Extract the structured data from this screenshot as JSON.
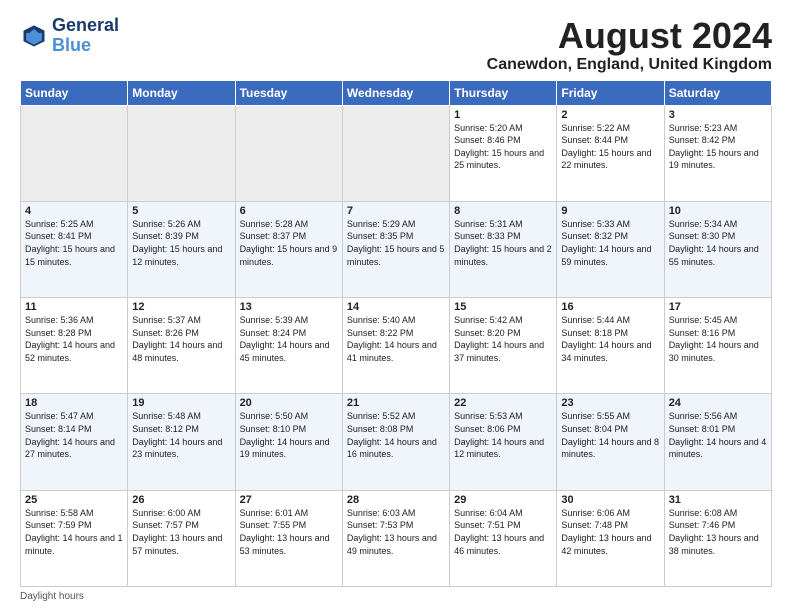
{
  "header": {
    "logo_line1": "General",
    "logo_line2": "Blue",
    "main_title": "August 2024",
    "subtitle": "Canewdon, England, United Kingdom"
  },
  "columns": [
    "Sunday",
    "Monday",
    "Tuesday",
    "Wednesday",
    "Thursday",
    "Friday",
    "Saturday"
  ],
  "weeks": [
    [
      {
        "day": "",
        "empty": true
      },
      {
        "day": "",
        "empty": true
      },
      {
        "day": "",
        "empty": true
      },
      {
        "day": "",
        "empty": true
      },
      {
        "day": "1",
        "sunrise": "Sunrise: 5:20 AM",
        "sunset": "Sunset: 8:46 PM",
        "daylight": "Daylight: 15 hours and 25 minutes."
      },
      {
        "day": "2",
        "sunrise": "Sunrise: 5:22 AM",
        "sunset": "Sunset: 8:44 PM",
        "daylight": "Daylight: 15 hours and 22 minutes."
      },
      {
        "day": "3",
        "sunrise": "Sunrise: 5:23 AM",
        "sunset": "Sunset: 8:42 PM",
        "daylight": "Daylight: 15 hours and 19 minutes."
      }
    ],
    [
      {
        "day": "4",
        "sunrise": "Sunrise: 5:25 AM",
        "sunset": "Sunset: 8:41 PM",
        "daylight": "Daylight: 15 hours and 15 minutes."
      },
      {
        "day": "5",
        "sunrise": "Sunrise: 5:26 AM",
        "sunset": "Sunset: 8:39 PM",
        "daylight": "Daylight: 15 hours and 12 minutes."
      },
      {
        "day": "6",
        "sunrise": "Sunrise: 5:28 AM",
        "sunset": "Sunset: 8:37 PM",
        "daylight": "Daylight: 15 hours and 9 minutes."
      },
      {
        "day": "7",
        "sunrise": "Sunrise: 5:29 AM",
        "sunset": "Sunset: 8:35 PM",
        "daylight": "Daylight: 15 hours and 5 minutes."
      },
      {
        "day": "8",
        "sunrise": "Sunrise: 5:31 AM",
        "sunset": "Sunset: 8:33 PM",
        "daylight": "Daylight: 15 hours and 2 minutes."
      },
      {
        "day": "9",
        "sunrise": "Sunrise: 5:33 AM",
        "sunset": "Sunset: 8:32 PM",
        "daylight": "Daylight: 14 hours and 59 minutes."
      },
      {
        "day": "10",
        "sunrise": "Sunrise: 5:34 AM",
        "sunset": "Sunset: 8:30 PM",
        "daylight": "Daylight: 14 hours and 55 minutes."
      }
    ],
    [
      {
        "day": "11",
        "sunrise": "Sunrise: 5:36 AM",
        "sunset": "Sunset: 8:28 PM",
        "daylight": "Daylight: 14 hours and 52 minutes."
      },
      {
        "day": "12",
        "sunrise": "Sunrise: 5:37 AM",
        "sunset": "Sunset: 8:26 PM",
        "daylight": "Daylight: 14 hours and 48 minutes."
      },
      {
        "day": "13",
        "sunrise": "Sunrise: 5:39 AM",
        "sunset": "Sunset: 8:24 PM",
        "daylight": "Daylight: 14 hours and 45 minutes."
      },
      {
        "day": "14",
        "sunrise": "Sunrise: 5:40 AM",
        "sunset": "Sunset: 8:22 PM",
        "daylight": "Daylight: 14 hours and 41 minutes."
      },
      {
        "day": "15",
        "sunrise": "Sunrise: 5:42 AM",
        "sunset": "Sunset: 8:20 PM",
        "daylight": "Daylight: 14 hours and 37 minutes."
      },
      {
        "day": "16",
        "sunrise": "Sunrise: 5:44 AM",
        "sunset": "Sunset: 8:18 PM",
        "daylight": "Daylight: 14 hours and 34 minutes."
      },
      {
        "day": "17",
        "sunrise": "Sunrise: 5:45 AM",
        "sunset": "Sunset: 8:16 PM",
        "daylight": "Daylight: 14 hours and 30 minutes."
      }
    ],
    [
      {
        "day": "18",
        "sunrise": "Sunrise: 5:47 AM",
        "sunset": "Sunset: 8:14 PM",
        "daylight": "Daylight: 14 hours and 27 minutes."
      },
      {
        "day": "19",
        "sunrise": "Sunrise: 5:48 AM",
        "sunset": "Sunset: 8:12 PM",
        "daylight": "Daylight: 14 hours and 23 minutes."
      },
      {
        "day": "20",
        "sunrise": "Sunrise: 5:50 AM",
        "sunset": "Sunset: 8:10 PM",
        "daylight": "Daylight: 14 hours and 19 minutes."
      },
      {
        "day": "21",
        "sunrise": "Sunrise: 5:52 AM",
        "sunset": "Sunset: 8:08 PM",
        "daylight": "Daylight: 14 hours and 16 minutes."
      },
      {
        "day": "22",
        "sunrise": "Sunrise: 5:53 AM",
        "sunset": "Sunset: 8:06 PM",
        "daylight": "Daylight: 14 hours and 12 minutes."
      },
      {
        "day": "23",
        "sunrise": "Sunrise: 5:55 AM",
        "sunset": "Sunset: 8:04 PM",
        "daylight": "Daylight: 14 hours and 8 minutes."
      },
      {
        "day": "24",
        "sunrise": "Sunrise: 5:56 AM",
        "sunset": "Sunset: 8:01 PM",
        "daylight": "Daylight: 14 hours and 4 minutes."
      }
    ],
    [
      {
        "day": "25",
        "sunrise": "Sunrise: 5:58 AM",
        "sunset": "Sunset: 7:59 PM",
        "daylight": "Daylight: 14 hours and 1 minute."
      },
      {
        "day": "26",
        "sunrise": "Sunrise: 6:00 AM",
        "sunset": "Sunset: 7:57 PM",
        "daylight": "Daylight: 13 hours and 57 minutes."
      },
      {
        "day": "27",
        "sunrise": "Sunrise: 6:01 AM",
        "sunset": "Sunset: 7:55 PM",
        "daylight": "Daylight: 13 hours and 53 minutes."
      },
      {
        "day": "28",
        "sunrise": "Sunrise: 6:03 AM",
        "sunset": "Sunset: 7:53 PM",
        "daylight": "Daylight: 13 hours and 49 minutes."
      },
      {
        "day": "29",
        "sunrise": "Sunrise: 6:04 AM",
        "sunset": "Sunset: 7:51 PM",
        "daylight": "Daylight: 13 hours and 46 minutes."
      },
      {
        "day": "30",
        "sunrise": "Sunrise: 6:06 AM",
        "sunset": "Sunset: 7:48 PM",
        "daylight": "Daylight: 13 hours and 42 minutes."
      },
      {
        "day": "31",
        "sunrise": "Sunrise: 6:08 AM",
        "sunset": "Sunset: 7:46 PM",
        "daylight": "Daylight: 13 hours and 38 minutes."
      }
    ]
  ],
  "footer": "Daylight hours"
}
